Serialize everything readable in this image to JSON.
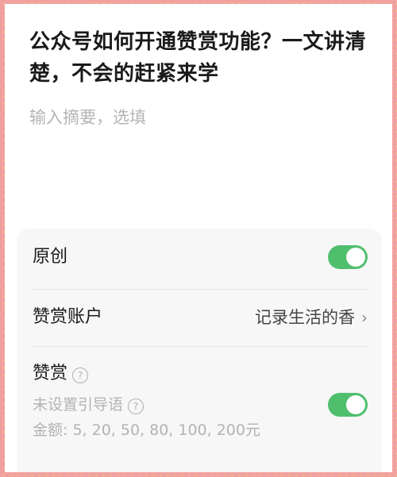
{
  "article": {
    "title": "公众号如何开通赞赏功能？一文讲清楚，不会的赶紧来学",
    "summary_placeholder": "输入摘要，选填"
  },
  "settings": {
    "original_label": "原创",
    "original_enabled": true,
    "account_label": "赞赏账户",
    "account_value": "记录生活的香",
    "reward_label": "赞赏",
    "guide_text": "未设置引导语",
    "amounts_text": "金额: 5, 20, 50, 80, 100, 200元",
    "reward_enabled": true
  },
  "icons": {
    "help": "question-circle-icon",
    "chevron": "chevron-right-icon"
  },
  "colors": {
    "toggle_on": "#4fbf6e",
    "frame": "#f2a09f"
  }
}
